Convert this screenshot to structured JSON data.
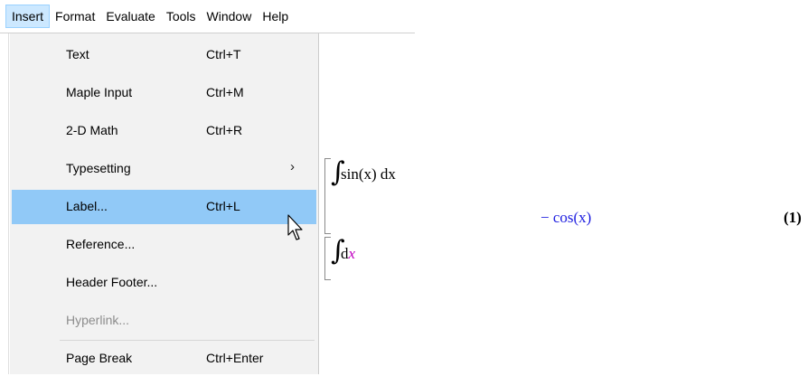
{
  "menubar": {
    "items": [
      {
        "label": "Insert",
        "active": true
      },
      {
        "label": "Format"
      },
      {
        "label": "Evaluate"
      },
      {
        "label": "Tools"
      },
      {
        "label": "Window"
      },
      {
        "label": "Help"
      }
    ]
  },
  "insert_menu": {
    "items": [
      {
        "label": "Text",
        "shortcut": "Ctrl+T"
      },
      {
        "label": "Maple Input",
        "shortcut": "Ctrl+M"
      },
      {
        "label": "2-D Math",
        "shortcut": "Ctrl+R"
      },
      {
        "label": "Typesetting",
        "shortcut": "",
        "submenu_arrow": "›"
      },
      {
        "label": "Label...",
        "shortcut": "Ctrl+L",
        "highlighted": true
      },
      {
        "label": "Reference...",
        "shortcut": ""
      },
      {
        "label": "Header Footer...",
        "shortcut": ""
      },
      {
        "label": "Hyperlink...",
        "shortcut": "",
        "disabled": true
      },
      {
        "label": "Page Break",
        "shortcut": "Ctrl+Enter"
      }
    ]
  },
  "worksheet": {
    "input1": {
      "integral_sign": "∫",
      "expr": "sin(x)  dx"
    },
    "output1": {
      "expr": "− cos(x)",
      "label": "(1)"
    },
    "input2": {
      "integral_sign": "∫",
      "d": "d",
      "var": "x"
    }
  },
  "colors": {
    "highlight": "#91c9f7",
    "menu_active": "#cce8ff",
    "result_blue": "#2020e0",
    "magenta": "#c000c0",
    "dropdown_bg": "#f2f2f2"
  }
}
